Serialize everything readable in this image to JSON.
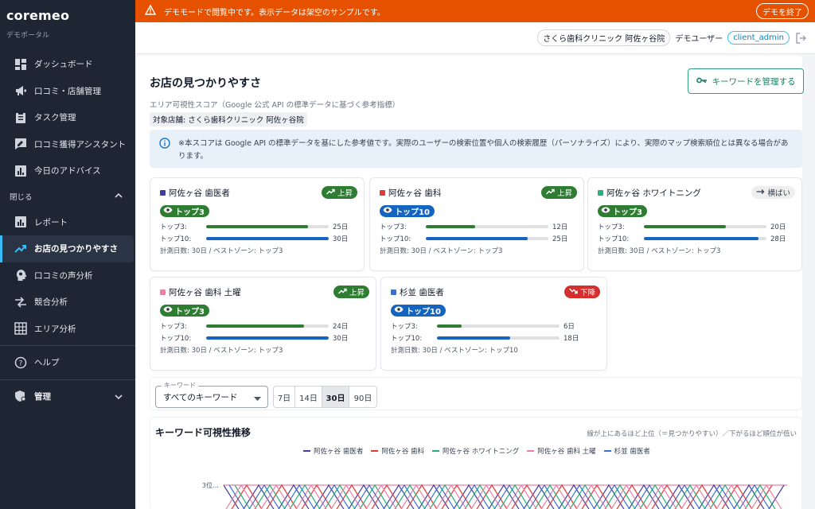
{
  "brand": {
    "title": "coremeo",
    "subtitle": "デモポータル"
  },
  "sidebar": {
    "items": [
      {
        "label": "ダッシュボード",
        "icon": "dashboard-icon"
      },
      {
        "label": "口コミ・店舗管理",
        "icon": "megaphone-icon"
      },
      {
        "label": "タスク管理",
        "icon": "clipboard-icon"
      },
      {
        "label": "口コミ獲得アシスタント",
        "icon": "edit-comment-icon"
      },
      {
        "label": "今日のアドバイス",
        "icon": "bar-chart-icon"
      }
    ],
    "section_label": "閉じる",
    "sub_items": [
      {
        "label": "レポート",
        "icon": "report-chart-icon"
      },
      {
        "label": "お店の見つかりやすさ",
        "icon": "trending-up-icon",
        "active": true
      },
      {
        "label": "口コミの声分析",
        "icon": "head-bulb-icon"
      },
      {
        "label": "競合分析",
        "icon": "compare-arrows-icon"
      },
      {
        "label": "エリア分析",
        "icon": "grid-icon"
      }
    ],
    "help_label": "ヘルプ",
    "admin_label": "管理"
  },
  "banner": {
    "text": "デモモードで閲覧中です。表示データは架空のサンプルです。",
    "exit_label": "デモを終了"
  },
  "userbar": {
    "store": "さくら歯科クリニック 阿佐ヶ谷院",
    "user": "デモユーザー",
    "role": "client_admin"
  },
  "page": {
    "title": "お店の見つかりやすさ",
    "manage_button": "キーワードを管理する",
    "subtitle": "エリア可視性スコア（Google 公式 API の標準データに基づく参考指標）",
    "store_tag": "対象店舗: さくら歯科クリニック 阿佐ヶ谷院",
    "info": "※本スコアは Google API の標準データを基にした参考値です。実際のユーザーの検索位置や個人の検索履歴（パーソナライズ）により、実際のマップ検索順位とは異なる場合があります。"
  },
  "labels": {
    "top3": "トップ3:",
    "top10": "トップ10:"
  },
  "cards": [
    {
      "name": "阿佐ヶ谷 歯医者",
      "color": "#3f3fa0",
      "trend": "上昇",
      "trend_type": "up",
      "badge": "トップ3",
      "badge_color": "green",
      "top3": 25,
      "top10": 30,
      "top3_label": "25日",
      "top10_label": "30日",
      "measure": "計測日数: 30日 / ベストゾーン: トップ3"
    },
    {
      "name": "阿佐ヶ谷 歯科",
      "color": "#e53935",
      "trend": "上昇",
      "trend_type": "up",
      "badge": "トップ10",
      "badge_color": "blue",
      "top3": 12,
      "top10": 25,
      "top3_label": "12日",
      "top10_label": "25日",
      "measure": "計測日数: 30日 / ベストゾーン: トップ3"
    },
    {
      "name": "阿佐ヶ谷 ホワイトニング",
      "color": "#26b07a",
      "trend": "横ばい",
      "trend_type": "flat",
      "badge": "トップ3",
      "badge_color": "green",
      "top3": 20,
      "top10": 28,
      "top3_label": "20日",
      "top10_label": "28日",
      "measure": "計測日数: 30日 / ベストゾーン: トップ3"
    },
    {
      "name": "阿佐ヶ谷 歯科 土曜",
      "color": "#ec7fa5",
      "trend": "上昇",
      "trend_type": "up",
      "badge": "トップ3",
      "badge_color": "green",
      "top3": 24,
      "top10": 30,
      "top3_label": "24日",
      "top10_label": "30日",
      "measure": "計測日数: 30日 / ベストゾーン: トップ3"
    },
    {
      "name": "杉並 歯医者",
      "color": "#3b6fd4",
      "trend": "下降",
      "trend_type": "down",
      "badge": "トップ10",
      "badge_color": "blue",
      "top3": 6,
      "top10": 18,
      "top3_label": "6日",
      "top10_label": "18日",
      "measure": "計測日数: 30日 / ベストゾーン: トップ10"
    }
  ],
  "filter": {
    "keyword_legend": "キーワード",
    "keyword_value": "すべてのキーワード",
    "periods": [
      "7日",
      "14日",
      "30日",
      "90日"
    ],
    "selected_period": "30日"
  },
  "chart": {
    "title": "キーワード可視性推移",
    "note": "線が上にあるほど上位（＝見つかりやすい）／下がるほど順位が低い",
    "y_tick": "3位",
    "series_names": [
      "阿佐ヶ谷 歯医者",
      "阿佐ヶ谷 歯科",
      "阿佐ヶ谷 ホワイトニング",
      "阿佐ヶ谷 歯科 土曜",
      "杉並 歯医者"
    ],
    "series_colors": [
      "#3f3fa0",
      "#e53935",
      "#26b07a",
      "#ec7fa5",
      "#3b6fd4"
    ]
  }
}
